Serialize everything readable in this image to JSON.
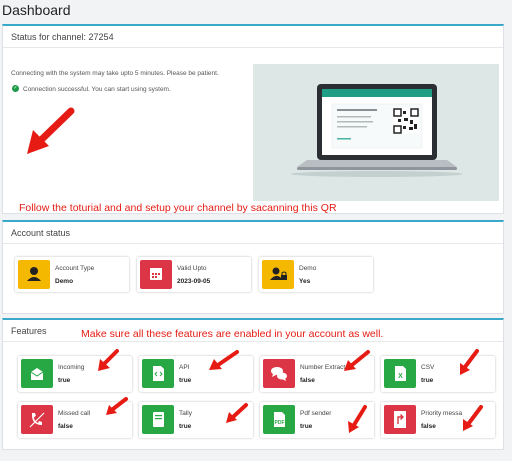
{
  "page": {
    "title": "Dashboard"
  },
  "status": {
    "header": "Status for channel: 27254",
    "connecting_text": "Connecting with the system may take upto 5 minutes. Please be patient.",
    "success_text": "Connection successful. You can start using system.",
    "tutorial_note": "Follow the toturial and and setup your channel by sacanning this QR"
  },
  "account": {
    "header": "Account status",
    "items": [
      {
        "label": "Account Type",
        "value": "Demo",
        "icon": "user-icon",
        "color": "#f5b800"
      },
      {
        "label": "Valid Upto",
        "value": "2023-09-05",
        "icon": "calendar-icon",
        "color": "#dc3545"
      },
      {
        "label": "Demo",
        "value": "Yes",
        "icon": "user-lock-icon",
        "color": "#f5b800"
      }
    ]
  },
  "features": {
    "header": "Features",
    "note": "Make sure all these features are enabled in your account as well.",
    "items": [
      {
        "label": "Incoming",
        "value": "true",
        "icon": "envelope-open-icon",
        "color": "#28a745"
      },
      {
        "label": "API",
        "value": "true",
        "icon": "code-file-icon",
        "color": "#28a745"
      },
      {
        "label": "Number Extractor",
        "value": "false",
        "icon": "comments-icon",
        "color": "#dc3545"
      },
      {
        "label": "CSV",
        "value": "true",
        "icon": "csv-file-icon",
        "color": "#28a745"
      },
      {
        "label": "Missed call",
        "value": "false",
        "icon": "missed-call-icon",
        "color": "#dc3545"
      },
      {
        "label": "Tally",
        "value": "true",
        "icon": "book-icon",
        "color": "#28a745"
      },
      {
        "label": "Pdf sender",
        "value": "true",
        "icon": "pdf-file-icon",
        "color": "#28a745"
      },
      {
        "label": "Priority messa",
        "value": "false",
        "icon": "priority-arrow-icon",
        "color": "#dc3545"
      }
    ]
  },
  "colors": {
    "accent": "#39a8c9",
    "annotation": "#e61b14",
    "success": "#28a745",
    "danger": "#dc3545",
    "warning": "#f5b800"
  }
}
